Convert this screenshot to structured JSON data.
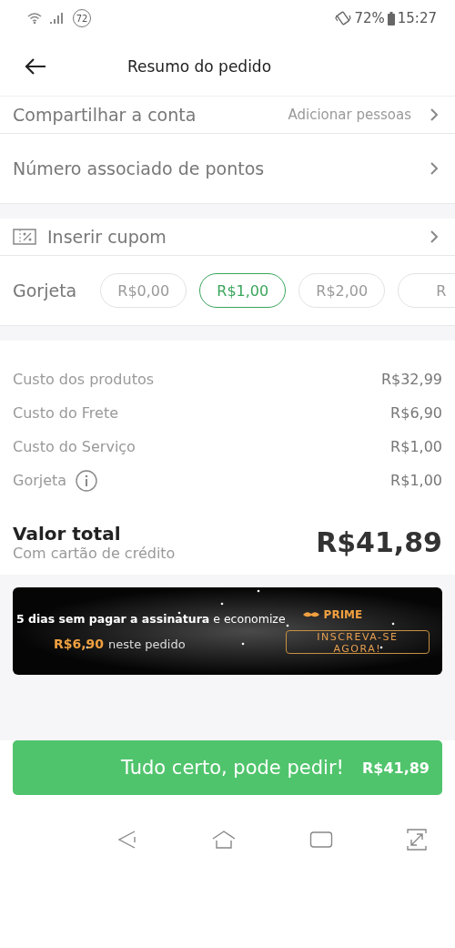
{
  "status_bar": {
    "notification_count": "72",
    "battery": "72%",
    "time": "15:27"
  },
  "header": {
    "title": "Resumo do pedido"
  },
  "options": [
    {
      "label": "Compartilhar a conta",
      "value": "Adicionar pessoas"
    },
    {
      "label": "Número associado de pontos"
    }
  ],
  "coupon": {
    "label": "Inserir cupom"
  },
  "tip": {
    "label": "Gorjeta",
    "options": [
      {
        "label": "R$0,00",
        "selected": false
      },
      {
        "label": "R$1,00",
        "selected": true
      },
      {
        "label": "R$2,00",
        "selected": false
      },
      {
        "label": "R",
        "selected": false
      }
    ]
  },
  "costs": [
    {
      "label": "Custo dos produtos",
      "value": "R$32,99",
      "info": false
    },
    {
      "label": "Custo do Frete",
      "value": "R$6,90",
      "info": false
    },
    {
      "label": "Custo do Serviço",
      "value": "R$1,00",
      "info": false
    },
    {
      "label": "Gorjeta",
      "value": "R$1,00",
      "info": true
    }
  ],
  "total": {
    "label": "Valor total",
    "payment": "Com cartão de crédito",
    "value": "R$41,89"
  },
  "promo": {
    "headline": "**5 dias sem pagar a assinatura** e economize",
    "savings": "R$6,90",
    "savings_note": "neste pedido",
    "brand": "PRIME",
    "button": "INSCREVA-SE AGORA!"
  },
  "checkout": {
    "label": "Tudo certo, pode pedir!",
    "value": "R$41,89"
  }
}
